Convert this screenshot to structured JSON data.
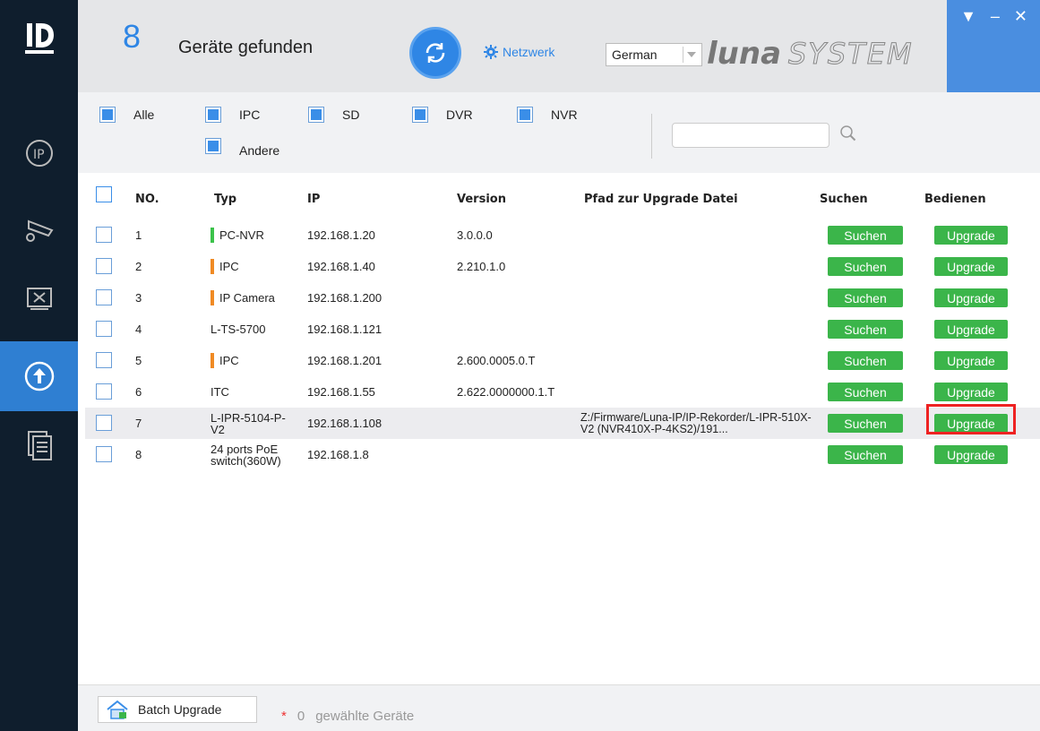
{
  "header": {
    "count": "8",
    "found_label": "Geräte gefunden",
    "network_label": "Netzwerk",
    "language": "German",
    "brand_luna": "luna",
    "brand_system": "SYSTEM"
  },
  "filters": [
    {
      "label": "Alle",
      "checked": true
    },
    {
      "label": "IPC",
      "checked": true
    },
    {
      "label": "SD",
      "checked": true
    },
    {
      "label": "DVR",
      "checked": true
    },
    {
      "label": "NVR",
      "checked": true
    },
    {
      "label": "Andere",
      "checked": true
    }
  ],
  "search": {
    "value": ""
  },
  "table": {
    "headers": {
      "no": "NO.",
      "type": "Typ",
      "ip": "IP",
      "version": "Version",
      "path": "Pfad zur Upgrade Datei",
      "search": "Suchen",
      "operate": "Bedienen"
    },
    "rows": [
      {
        "no": "1",
        "type": "PC-NVR",
        "type_color": "#3bc24a",
        "ip": "192.168.1.20",
        "version": "3.0.0.0",
        "path": ""
      },
      {
        "no": "2",
        "type": "IPC",
        "type_color": "#f08a24",
        "ip": "192.168.1.40",
        "version": "2.210.1.0",
        "path": ""
      },
      {
        "no": "3",
        "type": "IP Camera",
        "type_color": "#f08a24",
        "ip": "192.168.1.200",
        "version": "",
        "path": ""
      },
      {
        "no": "4",
        "type": "L-TS-5700",
        "type_color": "",
        "ip": "192.168.1.121",
        "version": "",
        "path": ""
      },
      {
        "no": "5",
        "type": "IPC",
        "type_color": "#f08a24",
        "ip": "192.168.1.201",
        "version": "2.600.0005.0.T",
        "path": ""
      },
      {
        "no": "6",
        "type": "ITC",
        "type_color": "",
        "ip": "192.168.1.55",
        "version": "2.622.0000000.1.T",
        "path": ""
      },
      {
        "no": "7",
        "type": "L-IPR-5104-P-V2",
        "type_color": "",
        "ip": "192.168.1.108",
        "version": "",
        "path": "Z:/Firmware/Luna-IP/IP-Rekorder/L-IPR-510X-V2 (NVR410X-P-4KS2)/191..."
      },
      {
        "no": "8",
        "type": "24 ports PoE switch(360W)",
        "type_color": "",
        "ip": "192.168.1.8",
        "version": "",
        "path": ""
      }
    ],
    "search_btn": "Suchen",
    "upgrade_btn": "Upgrade"
  },
  "bottom": {
    "batch_label": "Batch Upgrade",
    "star": "*",
    "selected_count": "0",
    "selected_label": "gewählte Geräte"
  },
  "colors": {
    "accent": "#2f86e5",
    "green": "#3bb54a",
    "sidebar": "#0f1e2d"
  }
}
